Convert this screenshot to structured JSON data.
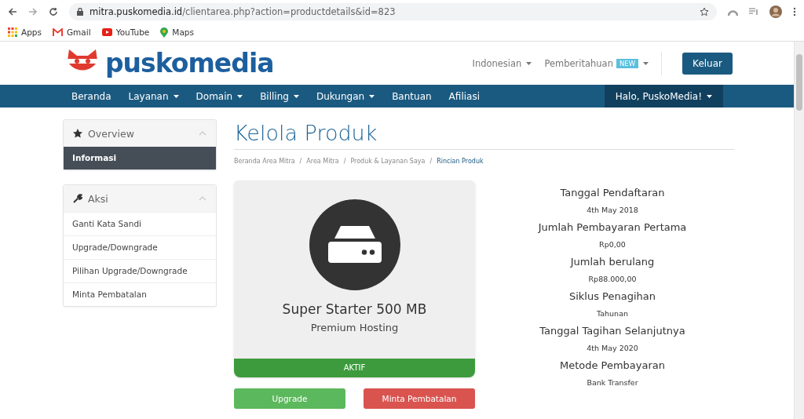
{
  "browser": {
    "url_host": "mitra.puskomedia.id",
    "url_path": "/clientarea.php?action=productdetails&id=823",
    "bookmarks": [
      {
        "label": "Apps",
        "kind": "apps"
      },
      {
        "label": "Gmail",
        "kind": "gmail"
      },
      {
        "label": "YouTube",
        "kind": "youtube"
      },
      {
        "label": "Maps",
        "kind": "maps"
      }
    ]
  },
  "header": {
    "logo": "puskomedia",
    "language": "Indonesian",
    "notifications": "Pemberitahuan",
    "badge": "NEW",
    "logout": "Keluar"
  },
  "nav": {
    "items": [
      {
        "label": "Beranda",
        "dropdown": false
      },
      {
        "label": "Layanan",
        "dropdown": true
      },
      {
        "label": "Domain",
        "dropdown": true
      },
      {
        "label": "Billing",
        "dropdown": true
      },
      {
        "label": "Dukungan",
        "dropdown": true
      },
      {
        "label": "Bantuan",
        "dropdown": false
      },
      {
        "label": "Afiliasi",
        "dropdown": false
      }
    ],
    "user": "Halo, PuskoMedia!"
  },
  "sidebar": [
    {
      "title": "Overview",
      "expanded": true,
      "items": [
        {
          "label": "Informasi",
          "selected": true
        }
      ]
    },
    {
      "title": "Aksi",
      "expanded": true,
      "items": [
        {
          "label": "Ganti Kata Sandi",
          "selected": false
        },
        {
          "label": "Upgrade/Downgrade",
          "selected": false
        },
        {
          "label": "Pilihan Upgrade/Downgrade",
          "selected": false
        },
        {
          "label": "Minta Pembatalan",
          "selected": false
        }
      ]
    }
  ],
  "page_title": "Kelola Produk",
  "breadcrumb": [
    {
      "label": "Beranda Area Mitra",
      "selected": false
    },
    {
      "separator": "/",
      "label": "Area Mitra",
      "selected": false
    },
    {
      "separator": "/",
      "label": "Produk & Layanan Saya",
      "selected": false
    },
    {
      "separator": "/",
      "label": "Rincian Produk",
      "selected": true
    }
  ],
  "product": {
    "name": "Super Starter 500 MB",
    "group": "Premium Hosting",
    "status": "AKTIF"
  },
  "actions": [
    {
      "label": "Upgrade",
      "kind": "success"
    },
    {
      "label": "Minta Pembatalan",
      "kind": "danger"
    }
  ],
  "details": [
    {
      "label": "Tanggal Pendaftaran",
      "value": "4th May 2018"
    },
    {
      "label": "Jumlah Pembayaran Pertama",
      "value": "Rp0,00"
    },
    {
      "label": "Jumlah berulang",
      "value": "Rp88.000,00"
    },
    {
      "label": "Siklus Penagihan",
      "value": "Tahunan"
    },
    {
      "label": "Tanggal Tagihan Selanjutnya",
      "value": "4th May 2020"
    },
    {
      "label": "Metode Pembayaran",
      "value": "Bank Transfer"
    }
  ]
}
